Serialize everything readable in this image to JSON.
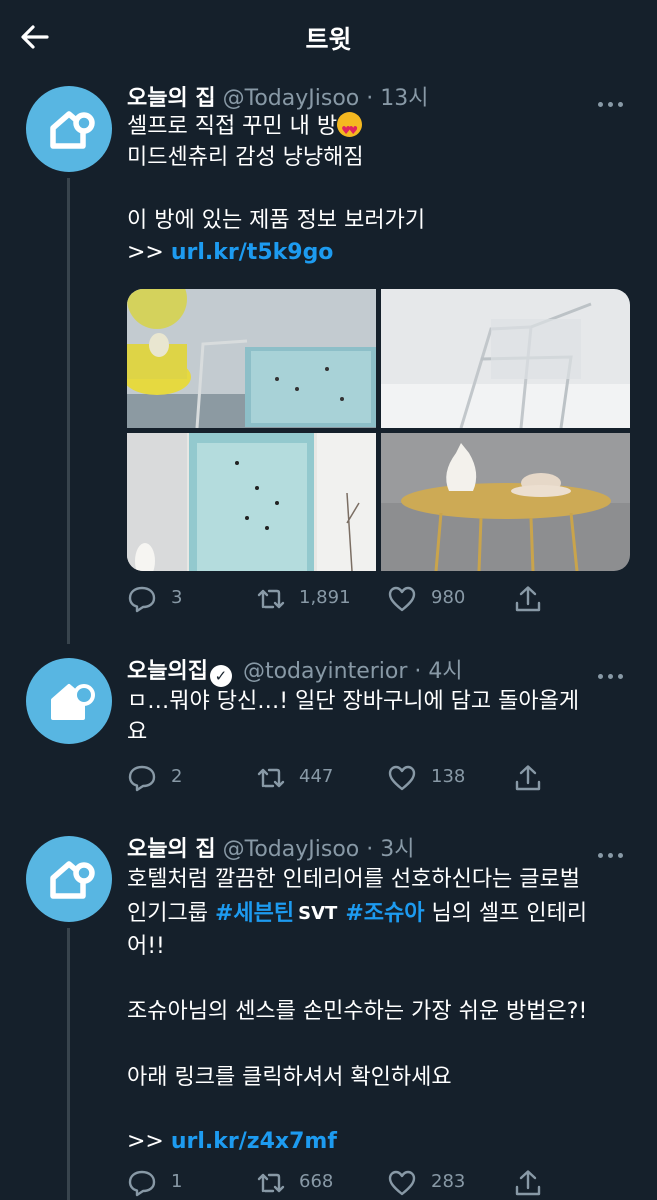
{
  "header": {
    "title": "트윗"
  },
  "tweets": [
    {
      "name": "오늘의 집",
      "handle": "@TodayJisoo",
      "sep": "·",
      "time": "13시",
      "lines": [
        "셀프로 직접 꾸민 내 방",
        "미드센츄리 감성 냥냥해짐",
        "",
        "이 방에 있는 제품 정보 보러가기"
      ],
      "link_prefix": ">> ",
      "link": "url.kr/t5k9go",
      "emoji": "heart-eyes-emoji",
      "counts": {
        "replies": "3",
        "retweets": "1,891",
        "likes": "980"
      }
    },
    {
      "name": "오늘의집",
      "handle": "@todayinterior",
      "sep": "·",
      "time": "4시",
      "verified": true,
      "lines": [
        "ㅁ…뭐야 당신…! 일단 장바구니에 담고 돌아올게",
        "요"
      ],
      "counts": {
        "replies": "2",
        "retweets": "447",
        "likes": "138"
      }
    },
    {
      "name": "오늘의 집",
      "handle": "@TodayJisoo",
      "sep": "·",
      "time": "3시",
      "line1": "호텔처럼 깔끔한 인테리어를 선호하신다는 글로벌",
      "line2_pre": "인기그룹 ",
      "hashtag1": "#세븐틴",
      "svt_logo": "SVT",
      "hashtag2": "#조슈아",
      "line2_post": " 님의 셀프 인테리",
      "line3": "어!!",
      "line5": "조슈아님의 센스를 손민수하는 가장 쉬운 방법은?!",
      "line7": "아래 링크를 클릭하셔서 확인하세요",
      "link_prefix": ">> ",
      "link": "url.kr/z4x7mf",
      "counts": {
        "replies": "1",
        "retweets": "668",
        "likes": "283"
      }
    }
  ],
  "colors": {
    "background": "#15202b",
    "accent": "#1d9bf0",
    "muted": "#8899a6",
    "avatar": "#58b6e2"
  }
}
